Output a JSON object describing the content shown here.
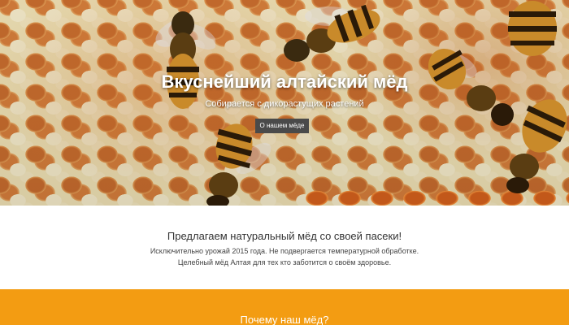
{
  "hero": {
    "title": "Вкуснейший алтайский мёд",
    "subtitle": "Собирается с дикорастущих растений",
    "button_label": "О нашем мёде"
  },
  "intro": {
    "title": "Предлагаем натуральный мёд со своей пасеки!",
    "line1": "Исключительно урожай 2015 года. Не подвергается температурной обработке.",
    "line2": "Целебный мёд Алтая для тех кто заботится о своём здоровье."
  },
  "why": {
    "title": "Почему наш мёд?"
  },
  "colors": {
    "accent": "#f39c12",
    "button": "#4a4a4a"
  }
}
